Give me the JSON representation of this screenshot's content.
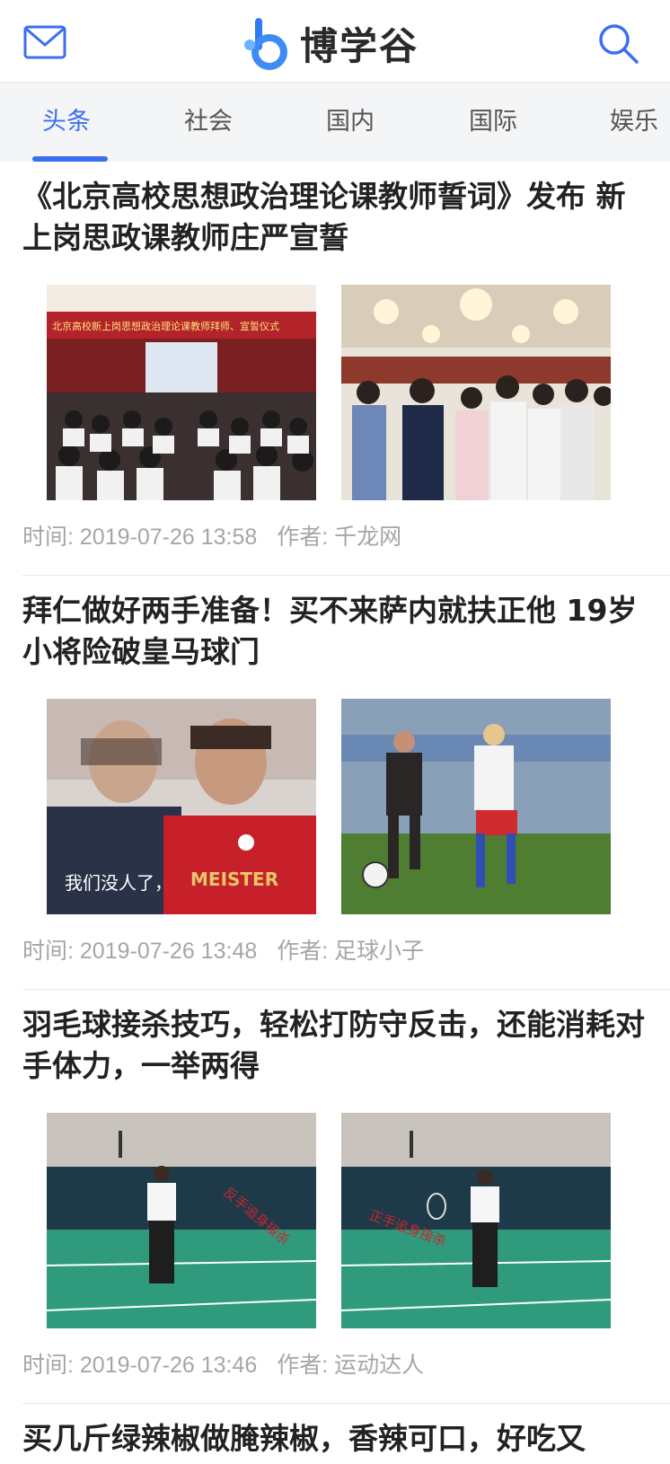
{
  "header": {
    "logo_text": "博学谷",
    "mail_icon": "mail-icon",
    "search_icon": "search-icon",
    "accent": "#3d6ef0"
  },
  "tabs": [
    {
      "label": "头条",
      "active": true
    },
    {
      "label": "社会",
      "active": false
    },
    {
      "label": "国内",
      "active": false
    },
    {
      "label": "国际",
      "active": false
    },
    {
      "label": "娱乐",
      "active": false
    }
  ],
  "articles": [
    {
      "title": "《北京高校思想政治理论课教师誓词》发布 新上岗思政课教师庄严宣誓",
      "time_label": "时间: 2019-07-26 13:58",
      "author_label": "作者: 千龙网",
      "banner_text": "北京高校新上岗思想政治理论课教师拜师、宣誓仪式"
    },
    {
      "title": "拜仁做好两手准备！买不来萨内就扶正他 19岁小将险破皇马球门",
      "time_label": "时间: 2019-07-26 13:48",
      "author_label": "作者: 足球小子",
      "caption_text": "我们没人了，",
      "shirt_text": "MEISTER"
    },
    {
      "title": "羽毛球接杀技巧，轻松打防守反击，还能消耗对手体力，一举两得",
      "time_label": "时间: 2019-07-26 13:46",
      "author_label": "作者: 运动达人",
      "overlay_left": "反手追身接杀",
      "overlay_right": "正手追身接杀"
    },
    {
      "title": "买几斤绿辣椒做腌辣椒，香辣可口，好吃又"
    }
  ]
}
